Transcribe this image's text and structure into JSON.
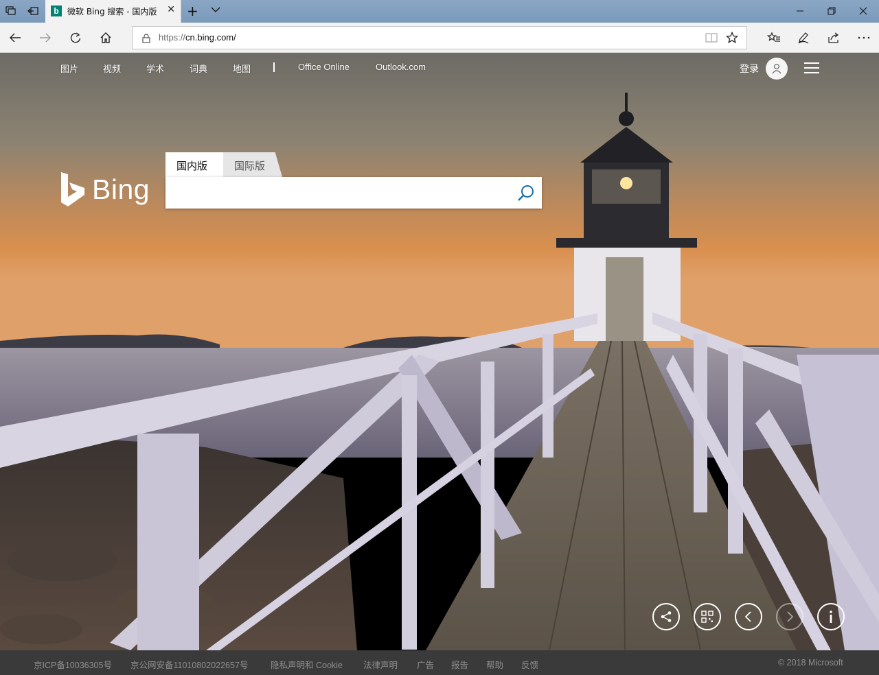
{
  "browser": {
    "tab_title": "微软 Bing 搜索 - 国内版",
    "favicon_letter": "b",
    "url_scheme": "https://",
    "url_host": "cn.bing.com/",
    "new_tab_glyph": "+",
    "close_glyph": "✕"
  },
  "topnav": {
    "links": [
      "图片",
      "视频",
      "学术",
      "词典",
      "地图"
    ],
    "office": "Office Online",
    "outlook": "Outlook.com",
    "login": "登录"
  },
  "logo": {
    "word": "Bing"
  },
  "search": {
    "tab_domestic": "国内版",
    "tab_international": "国际版",
    "value": "",
    "placeholder": ""
  },
  "footer": {
    "icp": "京ICP备10036305号",
    "police": "京公网安备11010802022657号",
    "privacy": "隐私声明和 Cookie",
    "legal": "法律声明",
    "ads": "广告",
    "report": "报告",
    "help": "帮助",
    "feedback": "反馈",
    "copyright": "© 2018 Microsoft"
  },
  "icons": [
    "tab-set-aside-icon",
    "back-tabs-icon",
    "bing-favicon-icon",
    "back-icon",
    "forward-icon",
    "refresh-icon",
    "home-icon",
    "lock-icon",
    "reading-view-icon",
    "favorite-star-icon",
    "favorites-hub-icon",
    "pen-icon",
    "share-icon",
    "more-icon",
    "user-icon",
    "hamburger-menu-icon",
    "search-icon",
    "share-image-icon",
    "qr-code-icon",
    "previous-image-icon",
    "next-image-icon",
    "info-icon"
  ],
  "colors": {
    "bing_teal": "#008373",
    "search_icon": "#1a6ca8",
    "footer_bg": "#3a3a3a"
  }
}
